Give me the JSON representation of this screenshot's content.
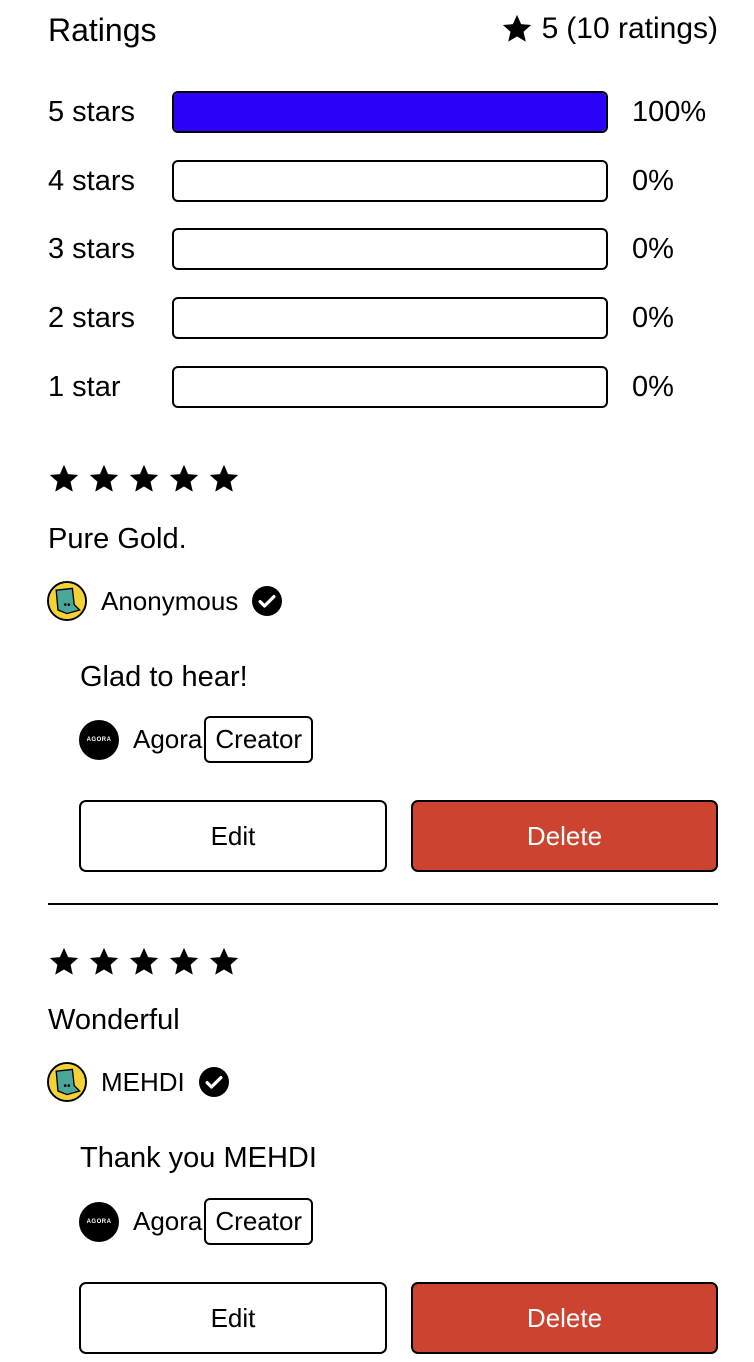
{
  "header": {
    "title": "Ratings",
    "average": "5",
    "count_text": "(10 ratings)"
  },
  "breakdown": [
    {
      "label": "5 stars",
      "percent_text": "100%",
      "fraction": 1.0
    },
    {
      "label": "4 stars",
      "percent_text": "0%",
      "fraction": 0
    },
    {
      "label": "3 stars",
      "percent_text": "0%",
      "fraction": 0
    },
    {
      "label": "2 stars",
      "percent_text": "0%",
      "fraction": 0
    },
    {
      "label": "1 star",
      "percent_text": "0%",
      "fraction": 0
    }
  ],
  "colors": {
    "bar_fill": "#2d00f7",
    "delete": "#cc4430"
  },
  "reviews": [
    {
      "stars": 5,
      "text": "Pure Gold.",
      "author": "Anonymous",
      "reply": {
        "text": "Glad to hear!",
        "author": "Agora",
        "badge": "Creator"
      },
      "edit_label": "Edit",
      "delete_label": "Delete"
    },
    {
      "stars": 5,
      "text": "Wonderful",
      "author": "MEHDI",
      "reply": {
        "text": "Thank you MEHDI",
        "author": "Agora",
        "badge": "Creator"
      },
      "edit_label": "Edit",
      "delete_label": "Delete"
    }
  ],
  "avatar_logo_text": "AGORA"
}
